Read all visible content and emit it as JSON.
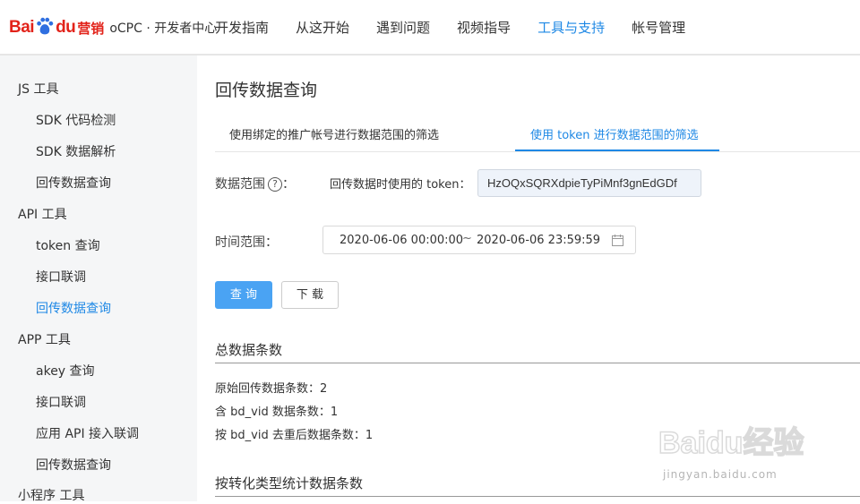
{
  "header": {
    "logo_bai": "Bai",
    "logo_du": "du",
    "logo_yingxiao": "营销",
    "logo_sub": "oCPC · 开发者中心",
    "nav": [
      {
        "label": "开发指南"
      },
      {
        "label": "从这开始"
      },
      {
        "label": "遇到问题"
      },
      {
        "label": "视频指导"
      },
      {
        "label": "工具与支持",
        "active": true
      },
      {
        "label": "帐号管理"
      }
    ]
  },
  "sidebar": {
    "groups": [
      {
        "title": "JS 工具",
        "items": [
          "SDK 代码检测",
          "SDK 数据解析",
          "回传数据查询"
        ]
      },
      {
        "title": "API 工具",
        "items": [
          "token 查询",
          "接口联调",
          "回传数据查询"
        ]
      },
      {
        "title": "APP 工具",
        "items": [
          "akey 查询",
          "接口联调",
          "应用 API 接入联调",
          "回传数据查询"
        ]
      },
      {
        "title": "小程序 工具",
        "items": []
      }
    ],
    "active_item": "API 工具 / 回传数据查询"
  },
  "main": {
    "title": "回传数据查询",
    "tabs": [
      {
        "label": "使用绑定的推广帐号进行数据范围的筛选"
      },
      {
        "label": "使用 token 进行数据范围的筛选",
        "active": true
      }
    ],
    "data_range_label": "数据范围",
    "data_range_colon": "：",
    "token_label": "回传数据时使用的 token：",
    "token_value": "HzOQxSQRXdpieTyPiMnf3gnEdGDf",
    "time_range_label": "时间范围：",
    "date_start": "2020-06-06 00:00:00",
    "date_sep": "~",
    "date_end": "2020-06-06 23:59:59",
    "query_button": "查 询",
    "download_button": "下 载",
    "total_title": "总数据条数",
    "stats": [
      "原始回传数据条数：2",
      "含 bd_vid 数据条数：1",
      "按 bd_vid 去重后数据条数：1"
    ],
    "by_type_title": "按转化类型统计数据条数"
  },
  "watermark": {
    "text": "Baidu经验",
    "url": "jingyan.baidu.com"
  },
  "colors": {
    "accent": "#1e88e5",
    "brand_red": "#e2231a",
    "primary_button": "#4aa3f3",
    "sidebar_bg": "#f5f6f7"
  }
}
